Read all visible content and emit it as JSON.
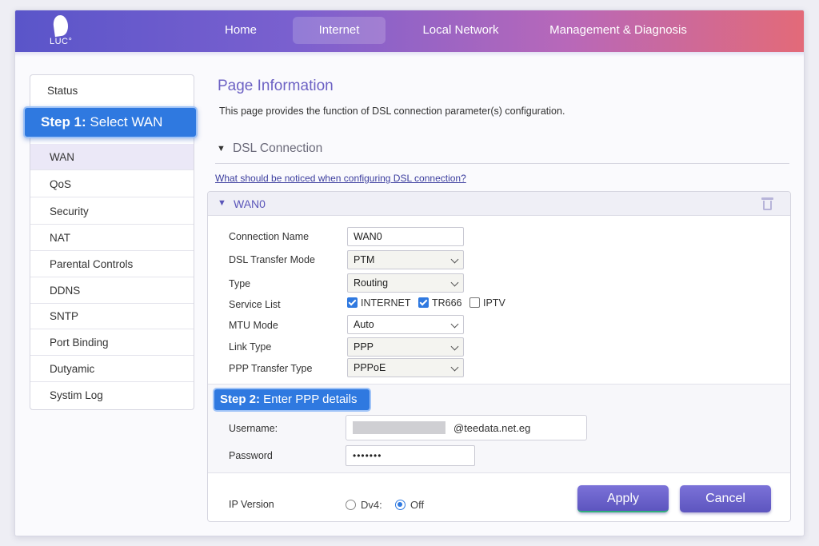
{
  "app": {
    "logo_text": "LUC°"
  },
  "nav": {
    "items": [
      {
        "label": "Home",
        "active": false
      },
      {
        "label": "Internet",
        "active": true
      },
      {
        "label": "Local Network",
        "active": false
      },
      {
        "label": "Management & Diagnosis",
        "active": false
      }
    ]
  },
  "sidebar": {
    "items": [
      {
        "label": "Status"
      },
      {
        "label": "WAN",
        "active": true
      },
      {
        "label": "QoS"
      },
      {
        "label": "Security"
      },
      {
        "label": "NAT"
      },
      {
        "label": "Parental Controls"
      },
      {
        "label": "DDNS"
      },
      {
        "label": "SNTP"
      },
      {
        "label": "Port Binding"
      },
      {
        "label": "Dutyamic"
      },
      {
        "label": "Systim Log"
      }
    ],
    "step1": {
      "prefix": "Step 1:",
      "text": " Select WAN"
    }
  },
  "main": {
    "title": "Page Information",
    "description": "This page provides the function of DSL connection parameter(s) configuration.",
    "section_title": "DSL Connection",
    "help_link": "What should be noticed when configuring DSL connection?"
  },
  "wan": {
    "title": "WAN0",
    "connection_name": {
      "label": "Connection Name",
      "value": "WAN0"
    },
    "transfer_mode": {
      "label": "DSL Transfer Mode",
      "value": "PTM"
    },
    "type": {
      "label": "Type",
      "value": "Routing"
    },
    "service_list": {
      "label": "Service List",
      "options": [
        {
          "label": "INTERNET",
          "checked": true
        },
        {
          "label": "TR666",
          "checked": true
        },
        {
          "label": "IPTV",
          "checked": false
        }
      ]
    },
    "mtu_mode": {
      "label": "MTU Mode",
      "value": "Auto"
    },
    "link_type": {
      "label": "Link Type",
      "value": "PPP"
    },
    "ppp_transfer_type": {
      "label": "PPP Transfer Type",
      "value": "PPPoE"
    }
  },
  "ppp": {
    "step2": {
      "prefix": "Step 2:",
      "text": " Enter PPP details"
    },
    "username": {
      "label": "Username:",
      "domain": "@teedata.net.eg"
    },
    "password": {
      "label": "Password",
      "value": "•••••••"
    }
  },
  "ip_version": {
    "label": "IP Version",
    "options": [
      {
        "label": "Dv4:",
        "selected": false
      },
      {
        "label": "Off",
        "selected": true
      }
    ]
  },
  "buttons": {
    "apply": "Apply",
    "cancel": "Cancel"
  },
  "colors": {
    "accent": "#5d55bf",
    "step_highlight": "#2f79e0",
    "title": "#6d62c4"
  }
}
